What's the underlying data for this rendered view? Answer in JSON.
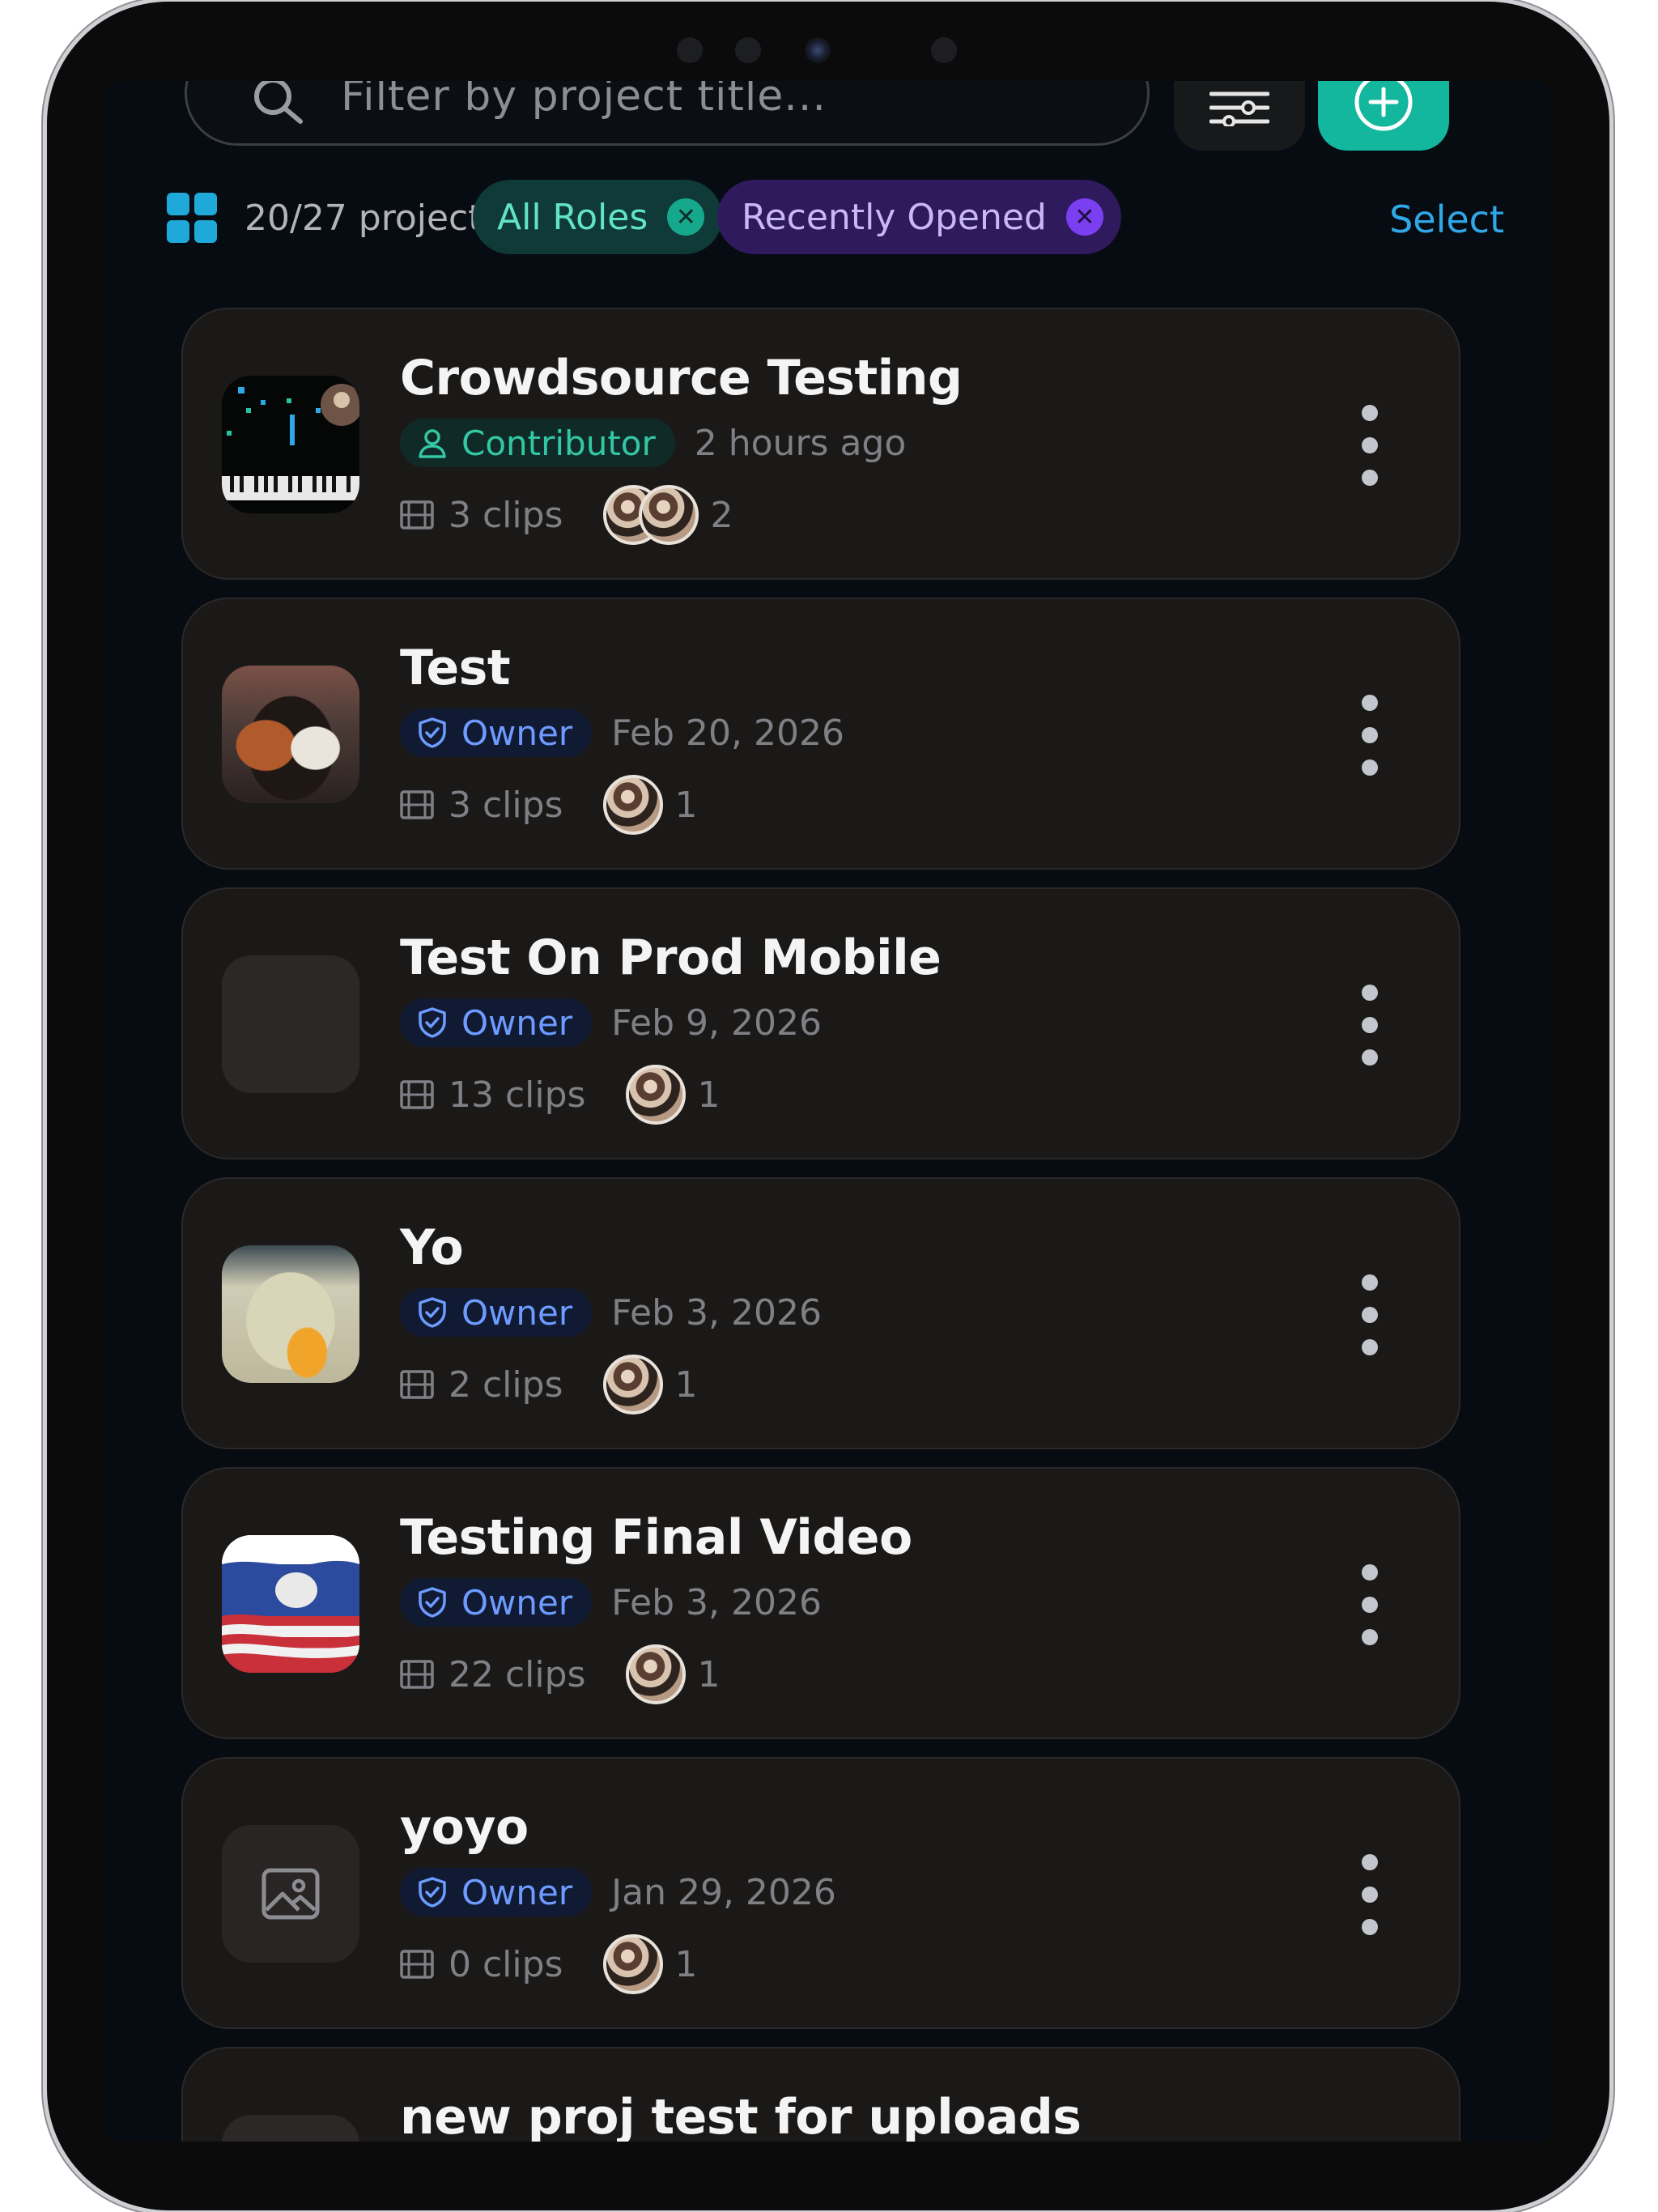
{
  "search": {
    "placeholder": "Filter by project title..."
  },
  "toolbar": {
    "filter_icon": "sliders-icon",
    "add_icon": "plus-circle-icon"
  },
  "filters": {
    "view_icon": "grid-icon",
    "count_label": "20/27 projects",
    "chips": [
      {
        "label": "All Roles",
        "color": "#62e3c8"
      },
      {
        "label": "Recently Opened",
        "color": "#c8b8f4"
      }
    ],
    "select_label": "Select"
  },
  "projects": [
    {
      "title": "Crowdsource Testing",
      "role": "Contributor",
      "date": "2 hours ago",
      "clips": "3 clips",
      "collaborators": "2",
      "thumb": "piano"
    },
    {
      "title": "Test",
      "role": "Owner",
      "date": "Feb 20, 2026",
      "clips": "3 clips",
      "collaborators": "1",
      "thumb": "food"
    },
    {
      "title": "Test On Prod Mobile",
      "role": "Owner",
      "date": "Feb 9, 2026",
      "clips": "13 clips",
      "collaborators": "1",
      "thumb": "empty"
    },
    {
      "title": "Yo",
      "role": "Owner",
      "date": "Feb 3, 2026",
      "clips": "2 clips",
      "collaborators": "1",
      "thumb": "eggs"
    },
    {
      "title": "Testing Final Video",
      "role": "Owner",
      "date": "Feb 3, 2026",
      "clips": "22 clips",
      "collaborators": "1",
      "thumb": "flag"
    },
    {
      "title": "yoyo",
      "role": "Owner",
      "date": "Jan 29, 2026",
      "clips": "0 clips",
      "collaborators": "1",
      "thumb": "image-placeholder"
    },
    {
      "title": "new proj test for uploads"
    }
  ],
  "colors": {
    "accent_teal": "#13b79e",
    "owner_blue": "#6d9bff",
    "contributor_green": "#34c7a4",
    "select_blue": "#2fa8e8",
    "purple_chip": "#7b3ff2"
  }
}
